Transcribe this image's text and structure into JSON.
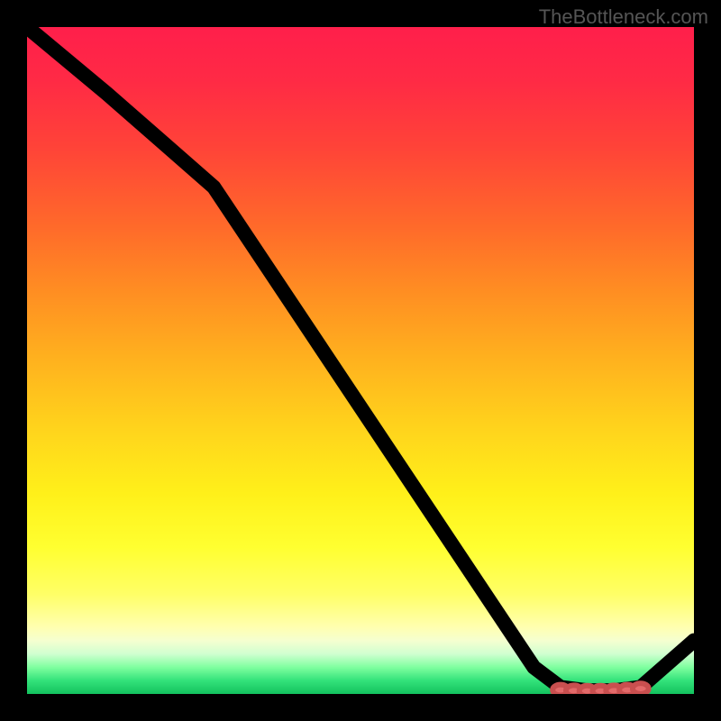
{
  "watermark": "TheBottleneck.com",
  "chart_data": {
    "type": "line",
    "title": "",
    "xlabel": "",
    "ylabel": "",
    "xlim": [
      0,
      100
    ],
    "ylim": [
      0,
      100
    ],
    "grid": false,
    "legend": false,
    "background": "gradient-red-yellow-green",
    "series": [
      {
        "name": "curve",
        "x": [
          0,
          12,
          20,
          28,
          36,
          44,
          52,
          60,
          68,
          76,
          80,
          84,
          88,
          92,
          100
        ],
        "y": [
          100,
          90,
          83,
          76,
          64,
          52,
          40,
          28,
          16,
          4,
          1,
          0.5,
          0.5,
          1,
          8
        ]
      }
    ],
    "marked_region": {
      "name": "optimal-range",
      "x": [
        80,
        82,
        84,
        86,
        88,
        90,
        92
      ],
      "y": [
        0.6,
        0.5,
        0.45,
        0.45,
        0.5,
        0.6,
        0.8
      ]
    }
  }
}
